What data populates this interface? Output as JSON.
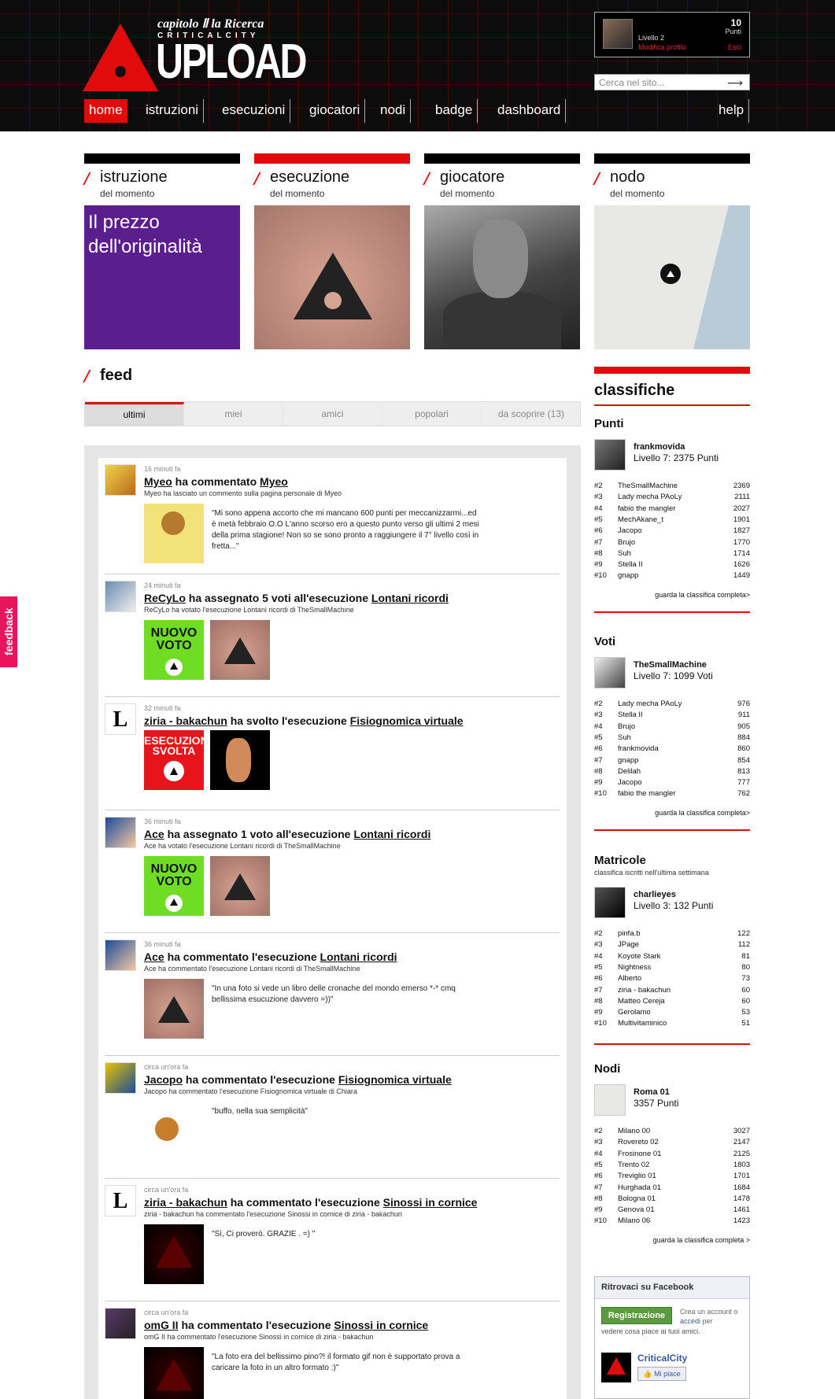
{
  "brand": {
    "kicker": "capitolo Ⅱ la Ricerca",
    "sub": "CRITICALCITY",
    "name": "UPLOAD"
  },
  "user": {
    "level": "Livello 2",
    "edit": "Modifica profilo",
    "points": "10",
    "points_label": "Punti",
    "logout": "Esci"
  },
  "search": {
    "placeholder": "Cerca nel sito..."
  },
  "nav": [
    "home",
    "istruzioni",
    "esecuzioni",
    "giocatori",
    "nodi",
    "badge",
    "dashboard"
  ],
  "nav_help": "help",
  "highlights": [
    {
      "title": "istruzione",
      "sub": "del momento",
      "text": "Il prezzo dell'originalità"
    },
    {
      "title": "esecuzione",
      "sub": "del momento"
    },
    {
      "title": "giocatore",
      "sub": "del momento"
    },
    {
      "title": "nodo",
      "sub": "del momento"
    }
  ],
  "feed": {
    "title": "feed",
    "tabs": [
      "ultimi",
      "miei",
      "amici",
      "popolari",
      "da scoprire (13)"
    ],
    "items": [
      {
        "time": "16 minuti fa",
        "head": [
          "Myeo",
          " ha commentato ",
          "Myeo"
        ],
        "sub": "Myeo ha lasciato un commento sulla pagina personale di Myeo",
        "quote": "\"Mi sono appena accorto che mi mancano 600 punti per meccanizzarmi...ed è metà febbraio O.O L'anno scorso ero a questo punto verso gli ultimi 2 mesi della prima stagione! Non so se sono pronto a raggiungere il 7° livello così in fretta...\""
      },
      {
        "time": "24 minuti fa",
        "head": [
          "ReCyLo",
          " ha assegnato 5 voti all'esecuzione ",
          "Lontani ricordi"
        ],
        "sub": "ReCyLo ha votato l'esecuzione Lontani ricordi di TheSmallMachine",
        "badge": "NUOVO VOTO"
      },
      {
        "time": "32 minuti fa",
        "head": [
          "ziria - bakachun",
          " ha svolto l'esecuzione ",
          "Fisiognomica virtuale"
        ],
        "badge": "ESECUZIONE SVOLTA"
      },
      {
        "time": "36 minuti fa",
        "head": [
          "Ace",
          " ha assegnato 1 voto all'esecuzione ",
          "Lontani ricordi"
        ],
        "sub": "Ace ha votato l'esecuzione Lontani ricordi di TheSmallMachine",
        "badge": "NUOVO VOTO"
      },
      {
        "time": "36 minuti fa",
        "head": [
          "Ace",
          " ha commentato l'esecuzione ",
          "Lontani ricordi"
        ],
        "sub": "Ace ha commentato l'esecuzione Lontani ricordi di TheSmallMachine",
        "quote": "\"In una foto si vede un libro delle cronache del mondo emerso *-* cmq bellissima esucuzione davvero =))\""
      },
      {
        "time": "circa un'ora fa",
        "head": [
          "Jacopo",
          " ha commentato l'esecuzione ",
          "Fisiognomica virtuale"
        ],
        "sub": "Jacopo ha commentato l'esecuzione Fisiognomica virtuale di Chiara",
        "quote": "\"buffo, nella sua semplicità\""
      },
      {
        "time": "circa un'ora fa",
        "head": [
          "ziria - bakachun",
          " ha commentato l'esecuzione ",
          "Sinossi in cornice"
        ],
        "sub": "ziria - bakachun ha commentato l'esecuzione Sinossi in cornice di ziria - bakachun",
        "quote": "\"Sì, Ci proverò. GRAZIE . =) \""
      },
      {
        "time": "circa un'ora fa",
        "head": [
          "omG II",
          " ha commentato l'esecuzione ",
          "Sinossi in cornice"
        ],
        "sub": "omG II ha commentato l'esecuzione Sinossi in cornice di ziria - bakachun",
        "quote": "\"La foto era del bellissimo pino?! il formato gif non è supportato prova a caricare la foto in un altro formato :)\""
      }
    ]
  },
  "sidebar": {
    "title": "classifiche",
    "more": "guarda la classifica completa>",
    "punti": {
      "title": "Punti",
      "top_name": "frankmovida",
      "top_value": "Livello 7: 2375 Punti",
      "rows": [
        [
          "#2",
          "TheSmallMachine",
          "2369"
        ],
        [
          "#3",
          "Lady mecha PAoLy",
          "2111"
        ],
        [
          "#4",
          "fabio the mangler",
          "2027"
        ],
        [
          "#5",
          "MechAkane_t",
          "1901"
        ],
        [
          "#6",
          "Jacopo",
          "1827"
        ],
        [
          "#7",
          "Brujo",
          "1770"
        ],
        [
          "#8",
          "Suh",
          "1714"
        ],
        [
          "#9",
          "Stella II",
          "1626"
        ],
        [
          "#10",
          "gnapp",
          "1449"
        ]
      ]
    },
    "voti": {
      "title": "Voti",
      "top_name": "TheSmallMachine",
      "top_value": "Livello 7: 1099 Voti",
      "rows": [
        [
          "#2",
          "Lady mecha PAoLy",
          "976"
        ],
        [
          "#3",
          "Stella II",
          "911"
        ],
        [
          "#4",
          "Brujo",
          "905"
        ],
        [
          "#5",
          "Suh",
          "884"
        ],
        [
          "#6",
          "frankmovida",
          "860"
        ],
        [
          "#7",
          "gnapp",
          "854"
        ],
        [
          "#8",
          "Delilah",
          "813"
        ],
        [
          "#9",
          "Jacopo",
          "777"
        ],
        [
          "#10",
          "fabio the mangler",
          "762"
        ]
      ]
    },
    "matricole": {
      "title": "Matricole",
      "sub": "classifica iscritti nell'ultima settimana",
      "top_name": "charlieyes",
      "top_value": "Livello 3: 132 Punti",
      "rows": [
        [
          "#2",
          "pinfa.b",
          "122"
        ],
        [
          "#3",
          "JPage",
          "112"
        ],
        [
          "#4",
          "Koyote Stark",
          "81"
        ],
        [
          "#5",
          "Nightness",
          "80"
        ],
        [
          "#6",
          "Alberto",
          "73"
        ],
        [
          "#7",
          "ziria - bakachun",
          "60"
        ],
        [
          "#8",
          "Matteo Cereja",
          "60"
        ],
        [
          "#9",
          "Gerolamo",
          "53"
        ],
        [
          "#10",
          "Multivitaminico",
          "51"
        ]
      ]
    },
    "nodi": {
      "title": "Nodi",
      "top_name": "Roma 01",
      "top_value": "3357 Punti",
      "rows": [
        [
          "#2",
          "Milano 00",
          "3027"
        ],
        [
          "#3",
          "Rovereto 02",
          "2147"
        ],
        [
          "#4",
          "Frosinone 01",
          "2125"
        ],
        [
          "#5",
          "Trento 02",
          "1803"
        ],
        [
          "#6",
          "Treviglio 01",
          "1701"
        ],
        [
          "#7",
          "Hurghada 01",
          "1684"
        ],
        [
          "#8",
          "Bologna 01",
          "1478"
        ],
        [
          "#9",
          "Genova 01",
          "1461"
        ],
        [
          "#10",
          "Milano 06",
          "1423"
        ]
      ],
      "more": "guarda la classifica completa >"
    }
  },
  "facebook": {
    "title": "Ritrovaci su Facebook",
    "register": "Registrazione",
    "create_text": "Crea un account o",
    "login": "accedi",
    "create_tail": "per",
    "see": "vedere cosa piace ai tuoi amici.",
    "page": "CriticalCity",
    "like": "Mi piace"
  },
  "feedback": "feedback"
}
